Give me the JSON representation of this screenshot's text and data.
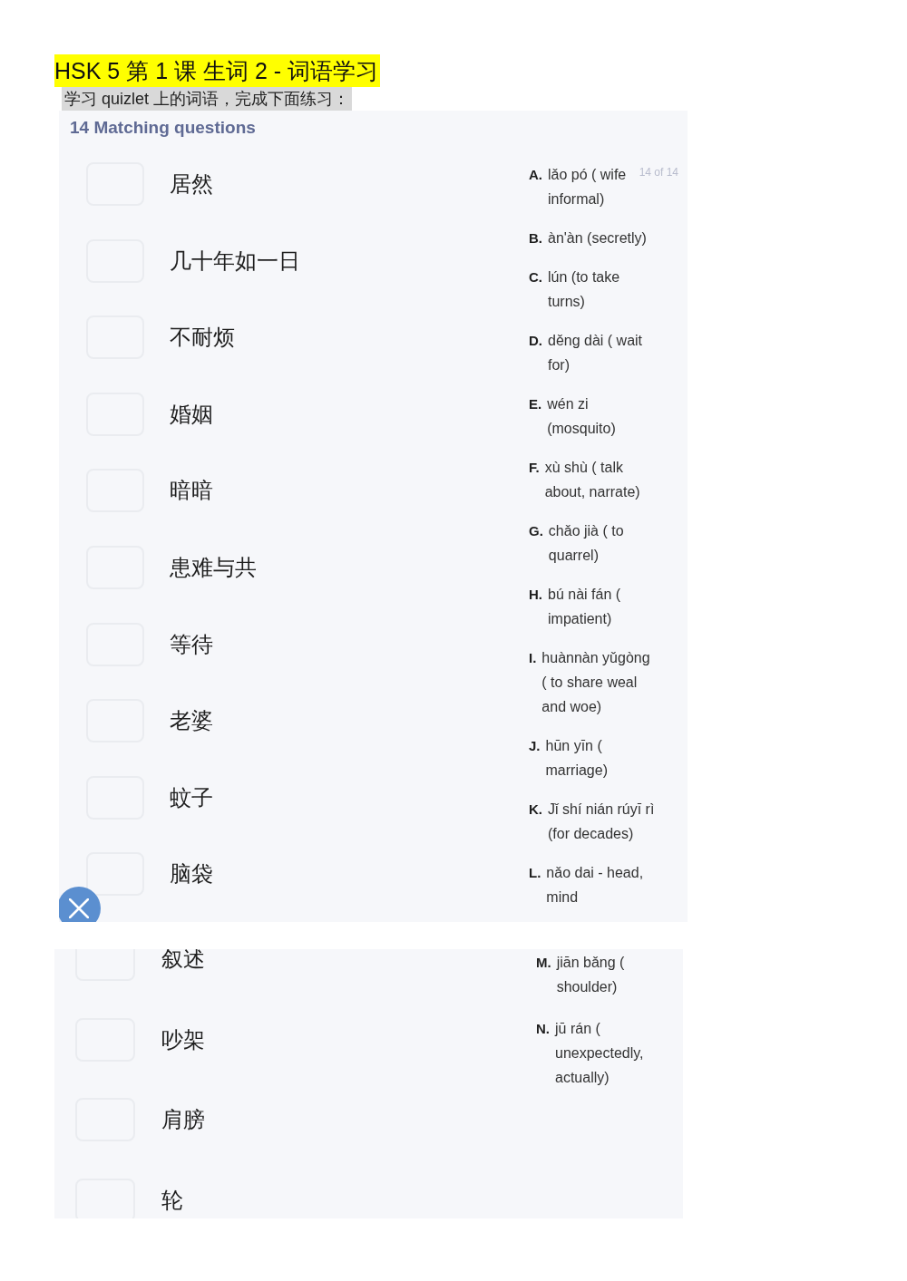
{
  "title": "HSK 5 第 1 课 生词 2 - 词语学习",
  "instruction": "学习 quizlet 上的词语，完成下面练习：",
  "quiz": {
    "heading": "14 Matching questions",
    "counter": "14 of 14"
  },
  "panels": [
    {
      "questions": [
        {
          "term": "居然"
        },
        {
          "term": "几十年如一日"
        },
        {
          "term": "不耐烦"
        },
        {
          "term": "婚姻"
        },
        {
          "term": "暗暗"
        },
        {
          "term": "患难与共"
        },
        {
          "term": "等待"
        },
        {
          "term": "老婆"
        },
        {
          "term": "蚊子"
        },
        {
          "term": "脑袋"
        }
      ],
      "answers": [
        {
          "letter": "A.",
          "text": "lǎo pó ( wife informal)"
        },
        {
          "letter": "B.",
          "text": "àn'àn (secretly)"
        },
        {
          "letter": "C.",
          "text": "lún (to take turns)"
        },
        {
          "letter": "D.",
          "text": "děng dài ( wait for)"
        },
        {
          "letter": "E.",
          "text": "wén zi (mosquito)"
        },
        {
          "letter": "F.",
          "text": "xù shù ( talk about, narrate)"
        },
        {
          "letter": "G.",
          "text": "chǎo jià ( to quarrel)"
        },
        {
          "letter": "H.",
          "text": "bú nài fán ( impatient)"
        },
        {
          "letter": "I.",
          "text": "huànnàn yǔgòng ( to share weal and woe)"
        },
        {
          "letter": "J.",
          "text": "hūn yīn ( marriage)"
        },
        {
          "letter": "K.",
          "text": "Jǐ shí nián rúyī rì (for decades)"
        },
        {
          "letter": "L.",
          "text": "nǎo dai - head, mind"
        }
      ]
    },
    {
      "questions": [
        {
          "term": "叙述"
        },
        {
          "term": "吵架"
        },
        {
          "term": "肩膀"
        },
        {
          "term": "轮"
        }
      ],
      "answers": [
        {
          "letter": "M.",
          "text": "jiān bǎng ( shoulder)"
        },
        {
          "letter": "N.",
          "text": "jū rán ( unexpectedly, actually)"
        }
      ]
    }
  ]
}
